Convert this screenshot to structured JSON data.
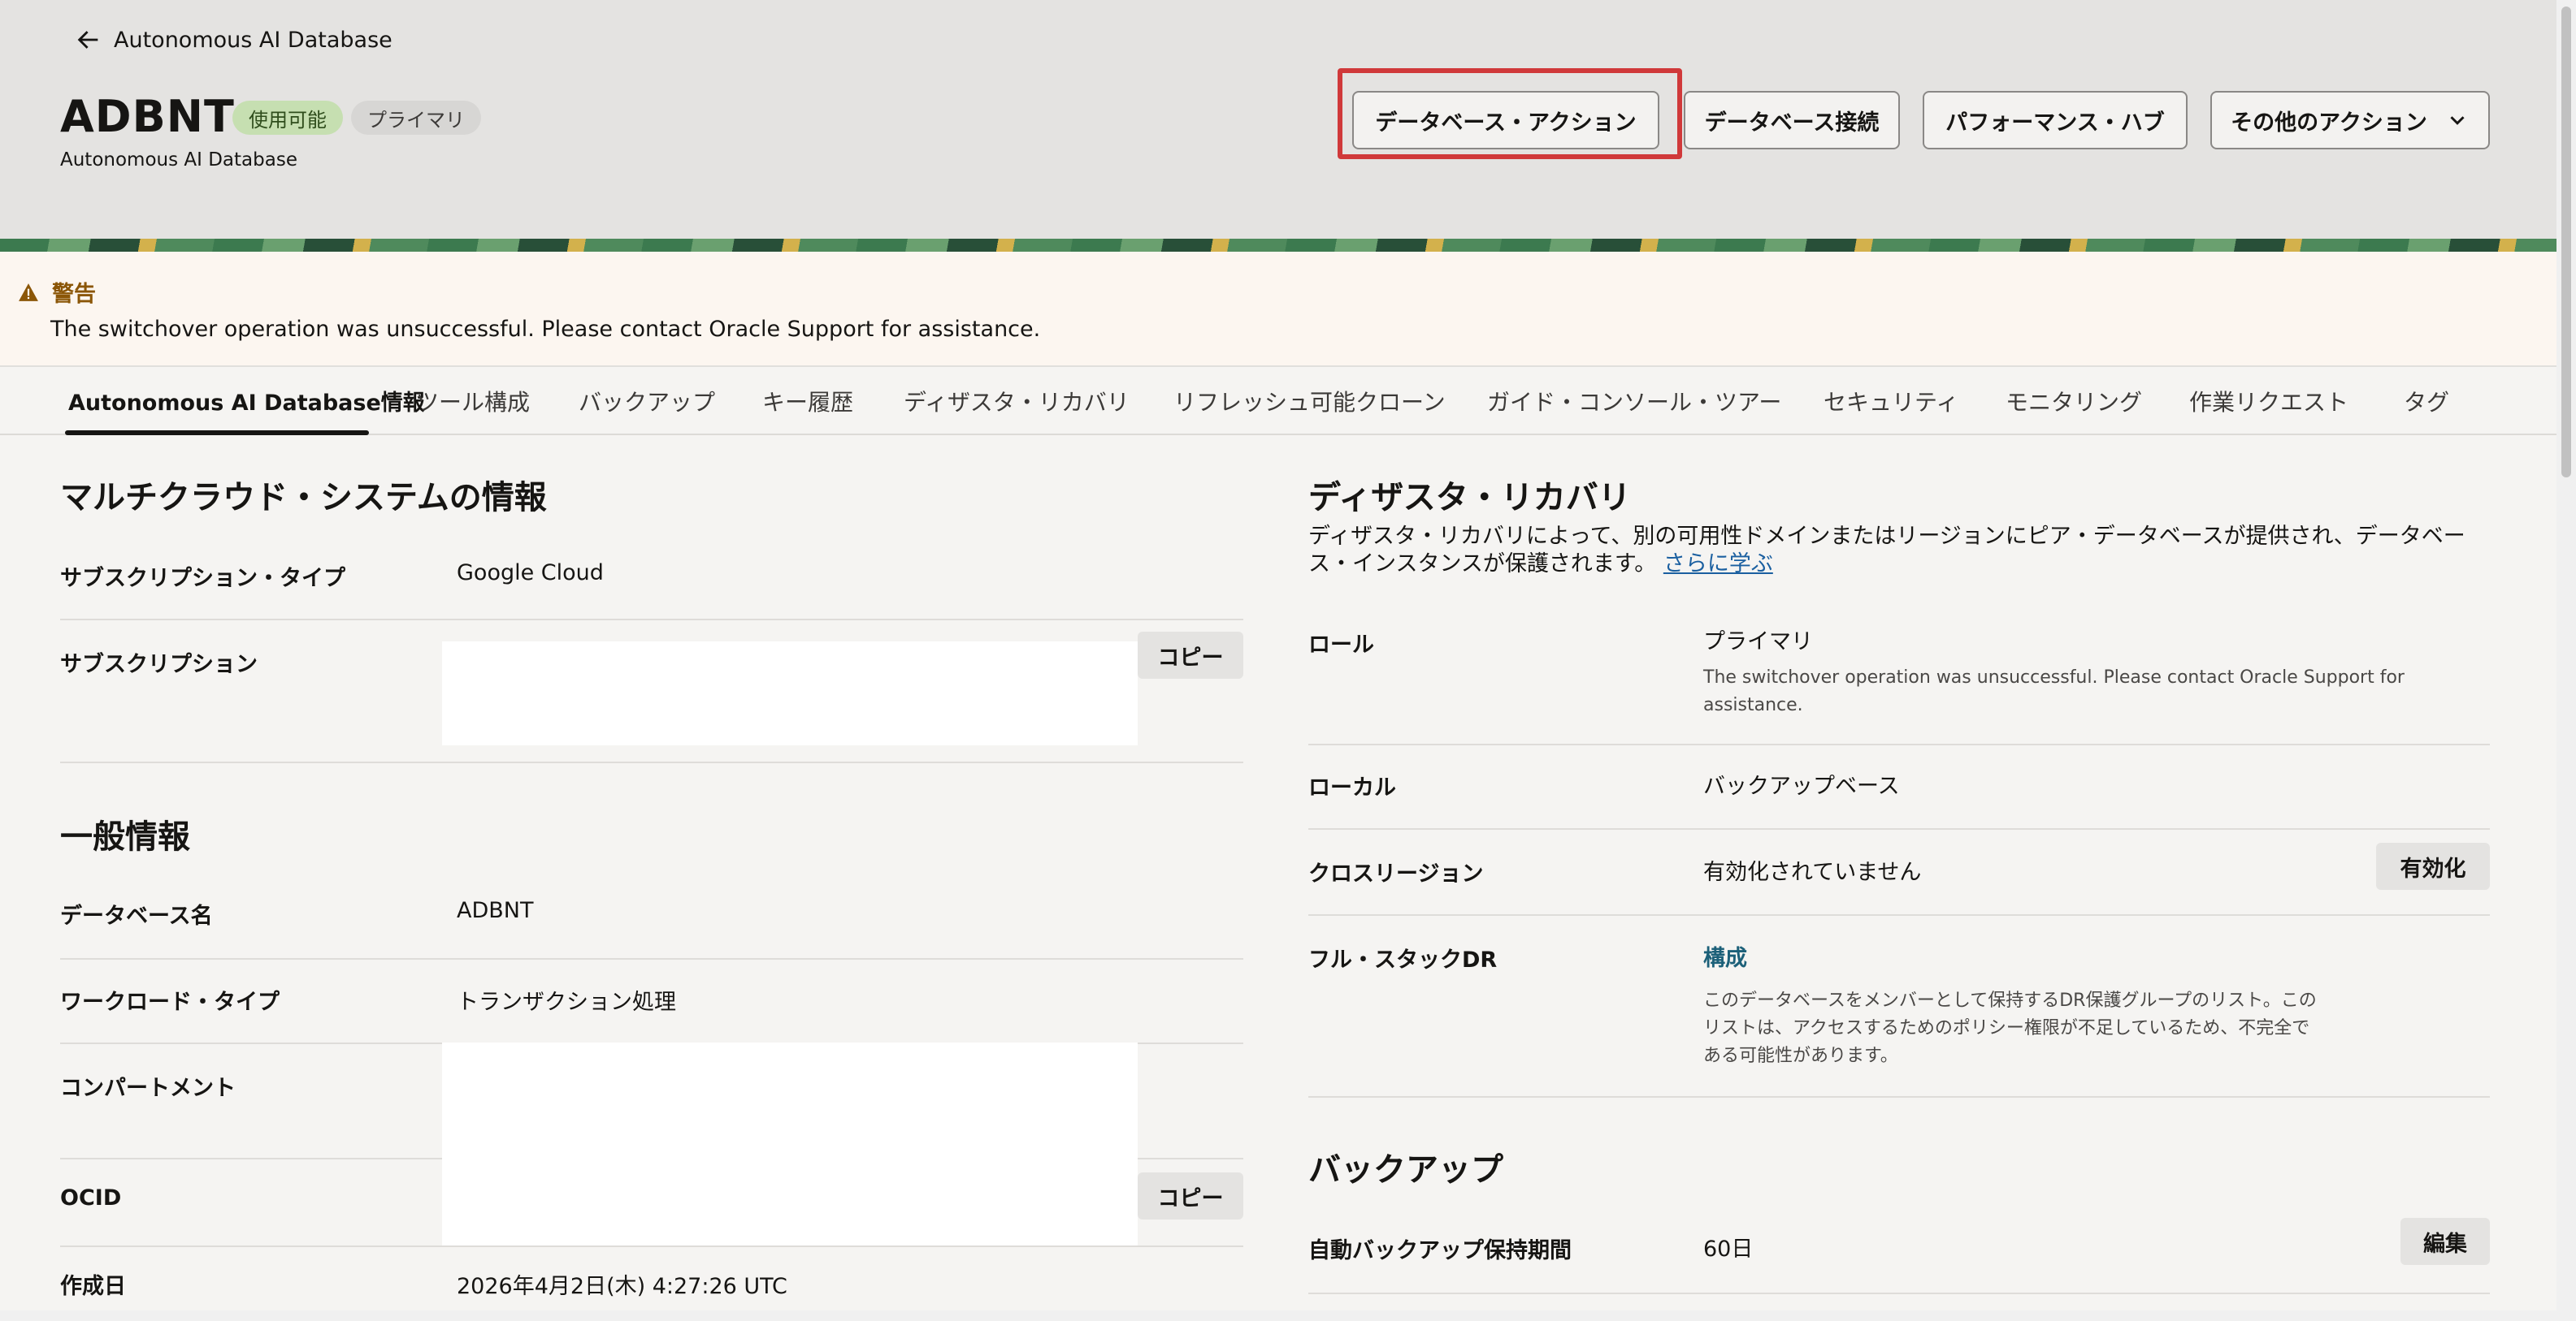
{
  "header": {
    "back_label": "Autonomous AI Database",
    "title": "ADBNT",
    "status_badge": "使用可能",
    "role_badge": "プライマリ",
    "subtitle": "Autonomous AI Database",
    "actions": {
      "db_actions": "データベース・アクション",
      "db_connect": "データベース接続",
      "perf_hub": "パフォーマンス・ハブ",
      "more_actions": "その他のアクション"
    }
  },
  "warning": {
    "title": "警告",
    "message": "The switchover operation was unsuccessful. Please contact Oracle Support for assistance."
  },
  "tabs": [
    "Autonomous AI Database情報",
    "ツール構成",
    "バックアップ",
    "キー履歴",
    "ディザスタ・リカバリ",
    "リフレッシュ可能クローン",
    "ガイド・コンソール・ツアー",
    "セキュリティ",
    "モニタリング",
    "作業リクエスト",
    "タグ"
  ],
  "multicloud": {
    "title": "マルチクラウド・システムの情報",
    "subscription_type_label": "サブスクリプション・タイプ",
    "subscription_type_value": "Google Cloud",
    "subscription_label": "サブスクリプション",
    "copy_label": "コピー"
  },
  "general": {
    "title": "一般情報",
    "db_name_label": "データベース名",
    "db_name_value": "ADBNT",
    "workload_label": "ワークロード・タイプ",
    "workload_value": "トランザクション処理",
    "compartment_label": "コンパートメント",
    "ocid_label": "OCID",
    "copy_label": "コピー",
    "created_label": "作成日",
    "created_value": "2026年4月2日(木) 4:27:26 UTC"
  },
  "dr": {
    "title": "ディザスタ・リカバリ",
    "desc_line1": "ディザスタ・リカバリによって、別の可用性ドメインまたはリージョンにピア・データベースが提供され、データベー",
    "desc_line2": "ス・インスタンスが保護されます。",
    "learn_more": "さらに学ぶ",
    "role_label": "ロール",
    "role_value": "プライマリ",
    "role_note_line1": "The switchover operation was unsuccessful. Please contact Oracle Support for",
    "role_note_line2": "assistance.",
    "local_label": "ローカル",
    "local_value": "バックアップベース",
    "cross_region_label": "クロスリージョン",
    "cross_region_value": "有効化されていません",
    "enable_label": "有効化",
    "full_stack_label": "フル・スタックDR",
    "full_stack_link": "構成",
    "full_stack_note_line1": "このデータベースをメンバーとして保持するDR保護グループのリスト。この",
    "full_stack_note_line2": "リストは、アクセスするためのポリシー権限が不足しているため、不完全で",
    "full_stack_note_line3": "ある可能性があります。"
  },
  "backup": {
    "title": "バックアップ",
    "retention_label": "自動バックアップ保持期間",
    "retention_value": "60日",
    "edit_label": "編集"
  }
}
